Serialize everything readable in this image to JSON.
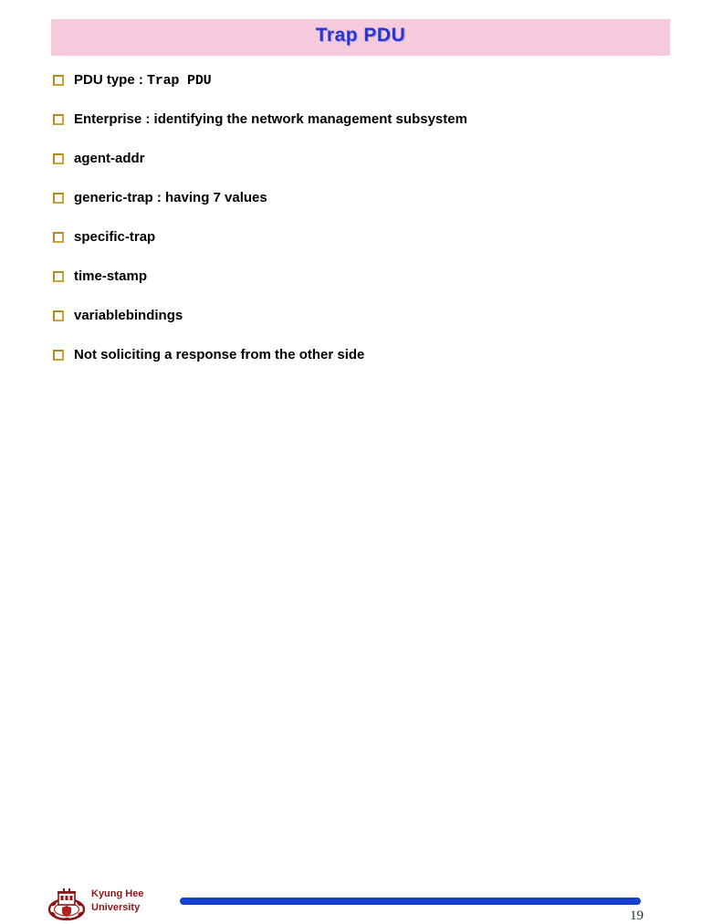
{
  "slide": {
    "title": "Trap PDU",
    "title_bar_color": "#f4cadc",
    "title_text_color": "#2836cf",
    "background_color": "#ffffff"
  },
  "bullets": [
    {
      "icon": "hollow-square-bullet",
      "text": "PDU type : ",
      "mono_text": "Trap PDU"
    },
    {
      "icon": "hollow-square-bullet",
      "text": "Enterprise : identifying the network management subsystem",
      "mono_text": ""
    },
    {
      "icon": "hollow-square-bullet",
      "text": "agent-addr",
      "mono_text": ""
    },
    {
      "icon": "hollow-square-bullet",
      "text": "generic-trap : having 7 values",
      "mono_text": ""
    },
    {
      "icon": "hollow-square-bullet",
      "text": "specific-trap",
      "mono_text": ""
    },
    {
      "icon": "hollow-square-bullet",
      "text": "time-stamp",
      "mono_text": ""
    },
    {
      "icon": "hollow-square-bullet",
      "text": "variablebindings",
      "mono_text": ""
    },
    {
      "icon": "hollow-square-bullet",
      "text": "Not soliciting a response from the other side",
      "mono_text": ""
    }
  ],
  "footer": {
    "logo_icon": "kyung-hee-university-crest",
    "organization": "Kyung Hee\nUniversity",
    "organization_color": "#8c1616",
    "rule_color": "#1540d0",
    "page_number": "19",
    "page_number_color": "#11381d"
  }
}
